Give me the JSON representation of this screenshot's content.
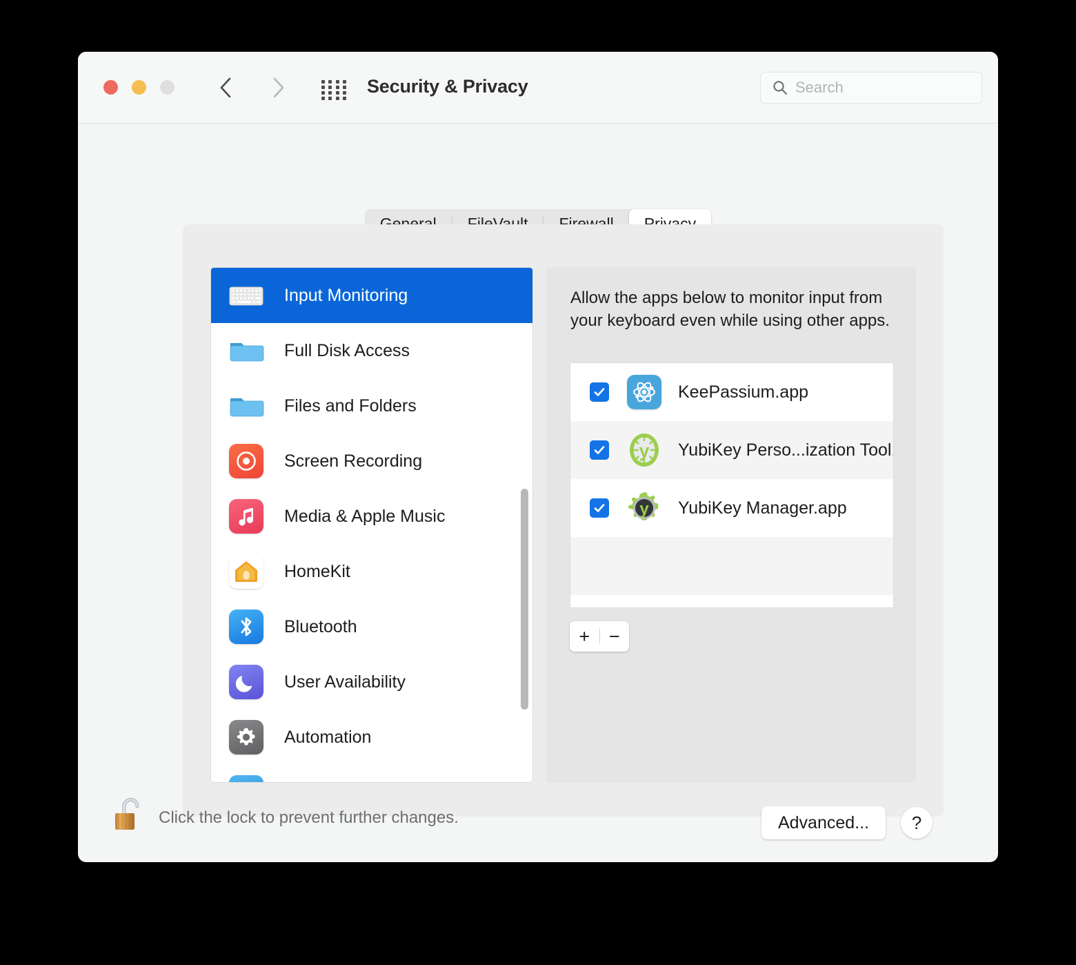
{
  "window": {
    "title": "Security & Privacy",
    "traffic_lights": [
      {
        "name": "close",
        "color": "#ED6A5E"
      },
      {
        "name": "minimize",
        "color": "#F6BE4F"
      },
      {
        "name": "zoom",
        "color": "#DEDFDE"
      }
    ]
  },
  "toolbar": {
    "back_icon": "chevron-left-icon",
    "forward_icon": "chevron-right-icon",
    "grid_icon": "show-all-grid-icon",
    "search": {
      "value": "",
      "placeholder": "Search",
      "icon": "search-icon"
    }
  },
  "tabs": [
    {
      "label": "General",
      "selected": false
    },
    {
      "label": "FileVault",
      "selected": false
    },
    {
      "label": "Firewall",
      "selected": false
    },
    {
      "label": "Privacy",
      "selected": true
    }
  ],
  "sidebar": {
    "items": [
      {
        "label": "Input Monitoring",
        "icon": "keyboard-icon",
        "selected": true
      },
      {
        "label": "Full Disk Access",
        "icon": "folder-icon",
        "selected": false
      },
      {
        "label": "Files and Folders",
        "icon": "folder-icon",
        "selected": false
      },
      {
        "label": "Screen Recording",
        "icon": "screen-record-icon",
        "selected": false
      },
      {
        "label": "Media & Apple Music",
        "icon": "music-note-icon",
        "selected": false
      },
      {
        "label": "HomeKit",
        "icon": "home-icon",
        "selected": false
      },
      {
        "label": "Bluetooth",
        "icon": "bluetooth-icon",
        "selected": false
      },
      {
        "label": "User Availability",
        "icon": "moon-icon",
        "selected": false
      },
      {
        "label": "Automation",
        "icon": "gear-icon",
        "selected": false
      },
      {
        "label": "",
        "icon": "accessibility-icon",
        "selected": false
      }
    ],
    "scrollbar": "vertical-scrollbar"
  },
  "main": {
    "description": "Allow the apps below to monitor input from your keyboard even while using other apps.",
    "apps": [
      {
        "name": "KeePassium.app",
        "checked": true,
        "icon": "keepassium-atom-icon"
      },
      {
        "name": "YubiKey Perso...ization Tool.app",
        "checked": true,
        "icon": "yubikey-personalization-icon"
      },
      {
        "name": "YubiKey Manager.app",
        "checked": true,
        "icon": "yubikey-manager-icon"
      }
    ],
    "add_label": "+",
    "remove_label": "−"
  },
  "footer": {
    "lock_icon": "unlocked-padlock-icon",
    "lock_text": "Click the lock to prevent further changes.",
    "advanced_label": "Advanced...",
    "help_label": "?"
  },
  "colors": {
    "accent": "#0A66D8",
    "checkbox": "#1473E6",
    "window_bg": "#F4F5F5",
    "panel_bg": "#ECECEC",
    "rightpane_bg": "#E5E5E5"
  }
}
